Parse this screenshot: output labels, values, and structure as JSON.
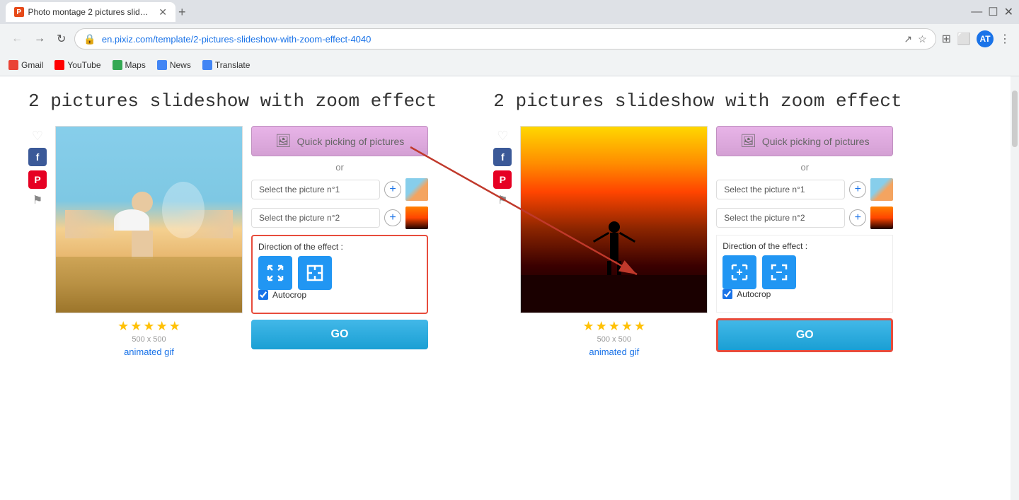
{
  "browser": {
    "tab_title": "Photo montage 2 pictures slides...",
    "tab_favicon": "P",
    "url": "en.pixiz.com/template/2-pictures-slideshow-with-zoom-effect-4040",
    "new_tab_label": "+",
    "bookmarks": [
      {
        "label": "Gmail",
        "color": "#EA4335"
      },
      {
        "label": "YouTube",
        "color": "#FF0000"
      },
      {
        "label": "Maps",
        "color": "#34A853"
      },
      {
        "label": "News",
        "color": "#4285F4"
      },
      {
        "label": "Translate",
        "color": "#4285F4"
      }
    ],
    "profile_initial": "AT"
  },
  "left_section": {
    "title": "2 pictures slideshow with zoom effect",
    "quick_pick_label": "Quick picking of pictures",
    "or_label": "or",
    "select_pic1_label": "Select the picture n°1",
    "select_pic2_label": "Select the picture n°2",
    "direction_label": "Direction of the effect :",
    "autocrop_label": "Autocrop",
    "go_label": "GO",
    "stars_count": 5,
    "size_label": "500 x 500",
    "animated_gif_label": "animated gif"
  },
  "right_section": {
    "title": "2 pictures slideshow with zoom effect",
    "quick_pick_label": "Quick picking of pictures",
    "or_label": "or",
    "select_pic1_label": "Select the picture n°1",
    "select_pic2_label": "Select the picture n°2",
    "direction_label": "Direction of the effect :",
    "autocrop_label": "Autocrop",
    "go_label": "GO",
    "stars_count": 5,
    "size_label": "500 x 500",
    "animated_gif_label": "animated gif"
  }
}
